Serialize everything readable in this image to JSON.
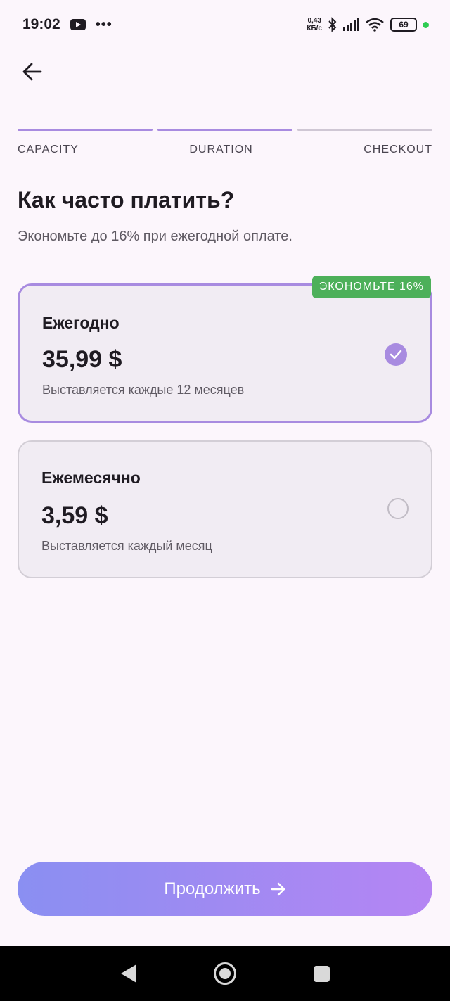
{
  "status_bar": {
    "time": "19:02",
    "more": "•••",
    "net_speed_value": "0,43",
    "net_speed_unit": "КБ/с",
    "battery": "69",
    "icons": [
      "youtube-icon",
      "bluetooth-icon",
      "signal-icon",
      "wifi-icon",
      "battery-icon"
    ]
  },
  "stepper": {
    "steps": [
      {
        "label": "CAPACITY",
        "active": true
      },
      {
        "label": "DURATION",
        "active": true
      },
      {
        "label": "CHECKOUT",
        "active": false
      }
    ]
  },
  "header": {
    "title": "Как часто платить?",
    "subtitle": "Экономьте до 16% при ежегодной оплате."
  },
  "plans": [
    {
      "name": "Ежегодно",
      "price": "35,99 $",
      "note": "Выставляется каждые 12 месяцев",
      "badge": "ЭКОНОМЬТЕ 16%",
      "selected": true
    },
    {
      "name": "Ежемесячно",
      "price": "3,59 $",
      "note": "Выставляется каждый месяц",
      "selected": false
    }
  ],
  "continue_button": {
    "label": "Продолжить"
  },
  "colors": {
    "background": "#fcf6fc",
    "accent": "#a88be0",
    "badge": "#4db05a",
    "button_gradient_start": "#8a8ff2",
    "button_gradient_end": "#b585f3"
  }
}
